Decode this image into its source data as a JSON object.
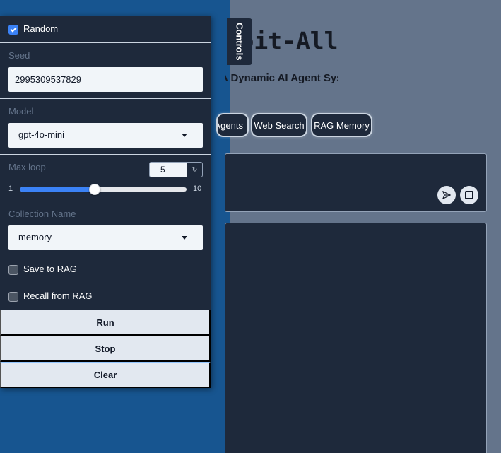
{
  "app": {
    "title": "Exploit-All",
    "subtitle": "A Dynamic AI Agent System"
  },
  "mode_buttons": [
    {
      "label": "Agents"
    },
    {
      "label": "Web Search"
    },
    {
      "label": "RAG Memory"
    }
  ],
  "controls_tab": {
    "label": "Controls"
  },
  "controls": {
    "random": {
      "label": "Random",
      "checked": true
    },
    "seed": {
      "label": "Seed",
      "value": "2995309537829"
    },
    "model": {
      "label": "Model",
      "value": "gpt-4o-mini"
    },
    "max_loop": {
      "label": "Max loop",
      "value": "5",
      "min": "1",
      "max": "10"
    },
    "collection_name": {
      "label": "Collection Name",
      "value": "memory"
    },
    "save_to_rag": {
      "label": "Save to RAG",
      "checked": false
    },
    "recall_from_rag": {
      "label": "Recall from RAG",
      "checked": false
    },
    "buttons": {
      "run": "Run",
      "stop": "Stop",
      "clear": "Clear"
    }
  },
  "colors": {
    "panel": "#1e293b",
    "accent": "#3b82f6",
    "backdrop_left": "#175590",
    "backdrop_right": "#64748b"
  }
}
